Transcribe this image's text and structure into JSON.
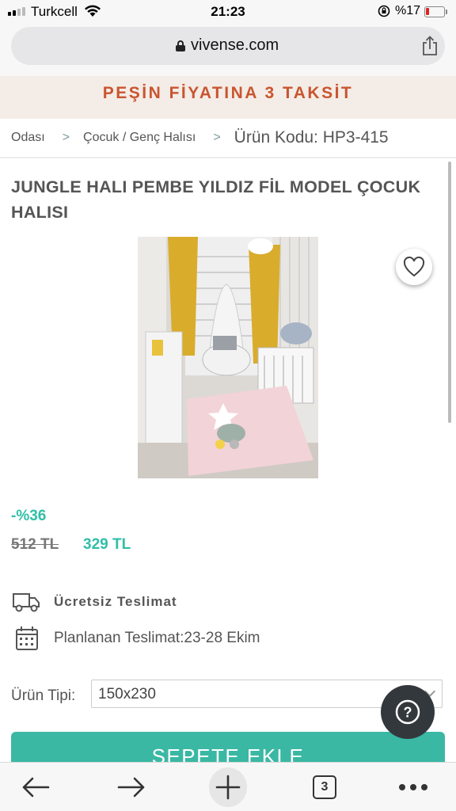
{
  "status_bar": {
    "carrier": "Turkcell",
    "time": "21:23",
    "battery": "%17"
  },
  "browser": {
    "url": "vivense.com",
    "open_tabs": "3"
  },
  "promo_banner": "PEŞİN FİYATINA 3 TAKSİT",
  "breadcrumb": {
    "items": [
      "Odası",
      "Çocuk / Genç Halısı"
    ],
    "separator": ">",
    "product_code": "Ürün Kodu: HP3-415"
  },
  "product": {
    "title": "JUNGLE HALI PEMBE YILDIZ FİL MODEL ÇOCUK HALISI",
    "discount": "-%36",
    "old_price": "512 TL",
    "new_price": "329 TL"
  },
  "delivery": {
    "free_shipping": "Ücretsiz Teslimat",
    "planned": "Planlanan Teslimat:23-28 Ekim"
  },
  "options": {
    "type_label": "Ürün Tipi:",
    "type_value": "150x230"
  },
  "cart_button": "SEPETE EKLE",
  "help_button": "?",
  "colors": {
    "accent": "#3ab8a4",
    "promo_text": "#c9552f",
    "promo_bg": "#f4ece6"
  },
  "icons": {
    "favorite": "heart-icon",
    "help": "question-icon",
    "truck": "truck-icon",
    "calendar": "calendar-icon",
    "share": "share-icon",
    "back": "back-arrow-icon",
    "forward": "forward-arrow-icon",
    "new_tab": "plus-icon",
    "menu": "more-dots-icon"
  }
}
